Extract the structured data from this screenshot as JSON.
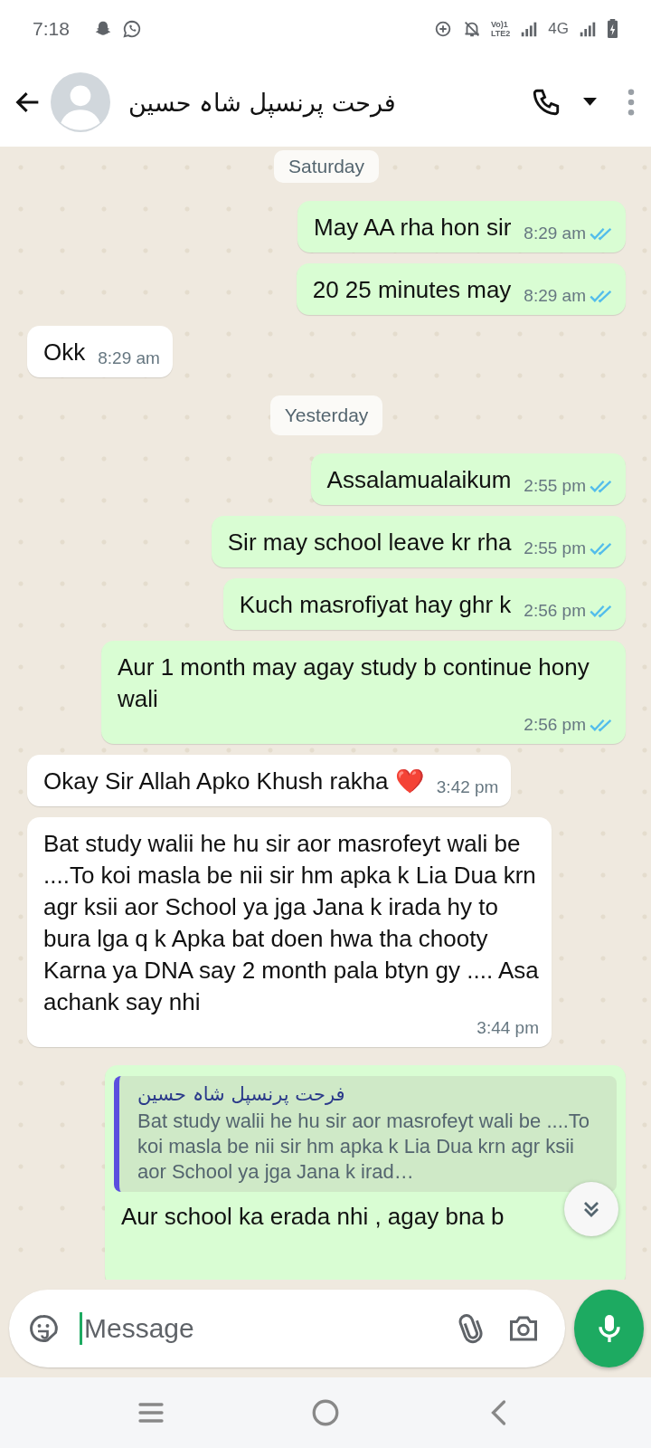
{
  "status_bar": {
    "time": "7:18",
    "volte_top": "Vo)1",
    "volte_bottom": "LTE2",
    "network": "4G"
  },
  "header": {
    "contact_name": "فرحت پرنسپل شاہ حسین"
  },
  "messages": [
    {
      "kind": "date",
      "text": "Saturday"
    },
    {
      "kind": "out",
      "text": "May AA rha hon sir",
      "time": "8:29 am",
      "read": true
    },
    {
      "kind": "out",
      "text": "20 25 minutes may",
      "time": "8:29 am",
      "read": true
    },
    {
      "kind": "in",
      "text": "Okk",
      "time": "8:29 am"
    },
    {
      "kind": "date",
      "text": "Yesterday"
    },
    {
      "kind": "out",
      "text": "Assalamualaikum",
      "time": "2:55 pm",
      "read": true
    },
    {
      "kind": "out",
      "text": "Sir may school leave kr rha",
      "time": "2:55 pm",
      "read": true
    },
    {
      "kind": "out",
      "text": "Kuch masrofiyat hay ghr k",
      "time": "2:56 pm",
      "read": true
    },
    {
      "kind": "out",
      "text": "Aur 1 month may agay study b continue hony wali",
      "time": "2:56 pm",
      "read": true
    },
    {
      "kind": "in",
      "text": "Okay Sir Allah Apko Khush rakha ❤️",
      "time": "3:42 pm"
    },
    {
      "kind": "in",
      "text": "Bat study walii he hu sir aor masrofeyt wali be ....To  koi masla be nii sir hm apka k Lia Dua krn agr ksii aor School ya jga Jana k irada hy to bura lga q k Apka  bat doen hwa tha chooty Karna ya DNA say 2 month pala btyn gy .... Asa achank say nhi",
      "time": "3:44 pm"
    },
    {
      "kind": "out",
      "text": "Aur school ka erada nhi , agay bna b",
      "quote": {
        "author": "فرحت پرنسپل شاہ حسین",
        "text": "Bat study walii he hu sir aor masrofeyt wali be ....To  koi masla be nii sir hm apka k Lia Dua krn agr ksii aor School ya jga Jana k irad…"
      }
    }
  ],
  "composer": {
    "placeholder": "Message"
  }
}
